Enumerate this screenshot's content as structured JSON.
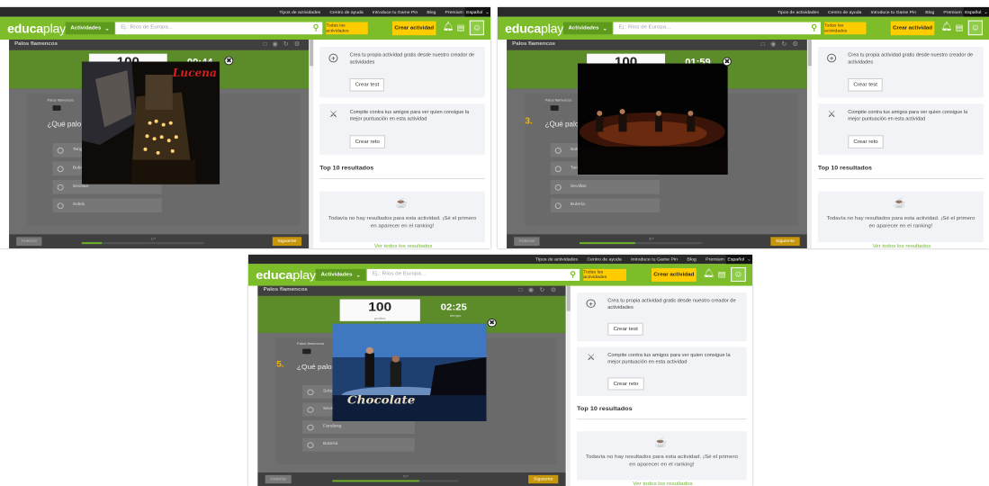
{
  "colors": {
    "brand_green": "#7dbd2a",
    "yellow": "#ffcc00",
    "dark": "#2a2a2a",
    "orange": "#f2b400"
  },
  "nav": {
    "top_links": [
      "Tipos de actividades",
      "Centro de ayuda",
      "Introduce tu Game Pin",
      "Blog",
      "Premium"
    ],
    "language": "Español",
    "logo_bold": "educa",
    "logo_thin": "play",
    "activities_button": "Actividades",
    "search_placeholder": "Ej.: Ríos de Europa...",
    "todas_button": "Todas las actividades",
    "crear_button": "Crear actividad",
    "icons": {
      "bell": "bell-icon",
      "news": "news-icon",
      "avatar": "user-avatar-icon",
      "search": "search-icon"
    }
  },
  "game": {
    "title": "Palos flamencos",
    "score": "100",
    "score_label": "puntos",
    "question_header": "Palos flamencos",
    "question_text": "¿Qué palo flamenco",
    "prev_button": "Anterior",
    "next_button": "Siguiente"
  },
  "sidebar": {
    "create_text": "Crea tu propia actividad gratis desde nuestro creador de actividades",
    "create_button": "Crear test",
    "challenge_text": "Compite contra tus amigos para ver quien consigue la mejor puntuación en esta actividad",
    "challenge_button": "Crear reto",
    "top10_title": "Top 10 resultados",
    "no_results": "Todavía no hay resultados para esta actividad. ¡Sé el primero en aparecer en el ranking!",
    "see_all": "Ver todos los resultados"
  },
  "panels": [
    {
      "timer": "00:44",
      "timer_label": "tiempo",
      "question_number": "",
      "progress_text": "1/7",
      "progress_fraction": 0.16,
      "options": [
        "Tango",
        "Bulería",
        "Sevillan",
        "Soleá"
      ],
      "media_caption": "Lucena",
      "media_caption_color": "#d41f1f",
      "media_scene": "procession"
    },
    {
      "timer": "01:59",
      "timer_label": "tiempo",
      "question_number": "3.",
      "progress_text": "3/7",
      "progress_fraction": 0.45,
      "options": [
        "Soleá",
        "Tango",
        "Sevillan",
        "Bulería"
      ],
      "media_caption": "",
      "media_caption_color": "#ffffff",
      "media_scene": "concert"
    },
    {
      "timer": "02:25",
      "timer_label": "tiempo",
      "question_number": "5.",
      "progress_text": "5/7",
      "progress_fraction": 0.69,
      "options": [
        "Soleá",
        "Sevillan",
        "Fandang",
        "Bulería"
      ],
      "media_caption": "Chocolate",
      "media_caption_color": "#e8dcc0",
      "media_scene": "tv-studio"
    }
  ]
}
